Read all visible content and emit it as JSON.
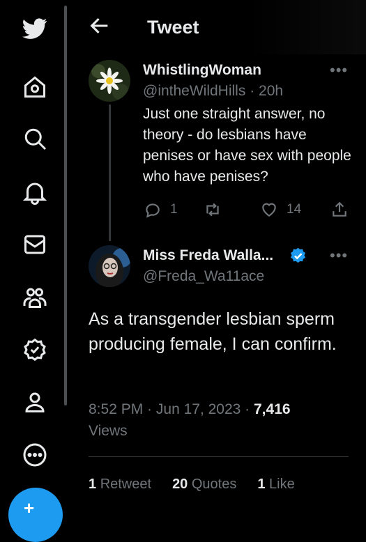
{
  "header": {
    "title": "Tweet"
  },
  "tweet1": {
    "name": "WhistlingWoman",
    "handle": "@intheWildHills",
    "time": "20h",
    "text": "Just one straight answer, no theory - do lesbians have penises or have sex with people who have penises?",
    "replies": "1",
    "likes": "14"
  },
  "tweet2": {
    "name": "Miss Freda Walla...",
    "handle": "@Freda_Wa11ace",
    "text": "As a transgender lesbian sperm producing female,  I can confirm.",
    "time": "8:52 PM",
    "date": "Jun 17, 2023",
    "views_count": "7,416",
    "views_label": "Views",
    "retweets_count": "1",
    "retweets_label": "Retweet",
    "quotes_count": "20",
    "quotes_label": "Quotes",
    "likes_count": "1",
    "likes_label": "Like"
  },
  "colors": {
    "accent": "#1d9bf0",
    "background": "#000000",
    "text": "#e7e9ea",
    "muted": "#71767b"
  },
  "icons": [
    "twitter-logo-icon",
    "home-icon",
    "search-icon",
    "bell-icon",
    "mail-icon",
    "communities-icon",
    "verified-orgs-icon",
    "profile-icon",
    "more-icon"
  ]
}
